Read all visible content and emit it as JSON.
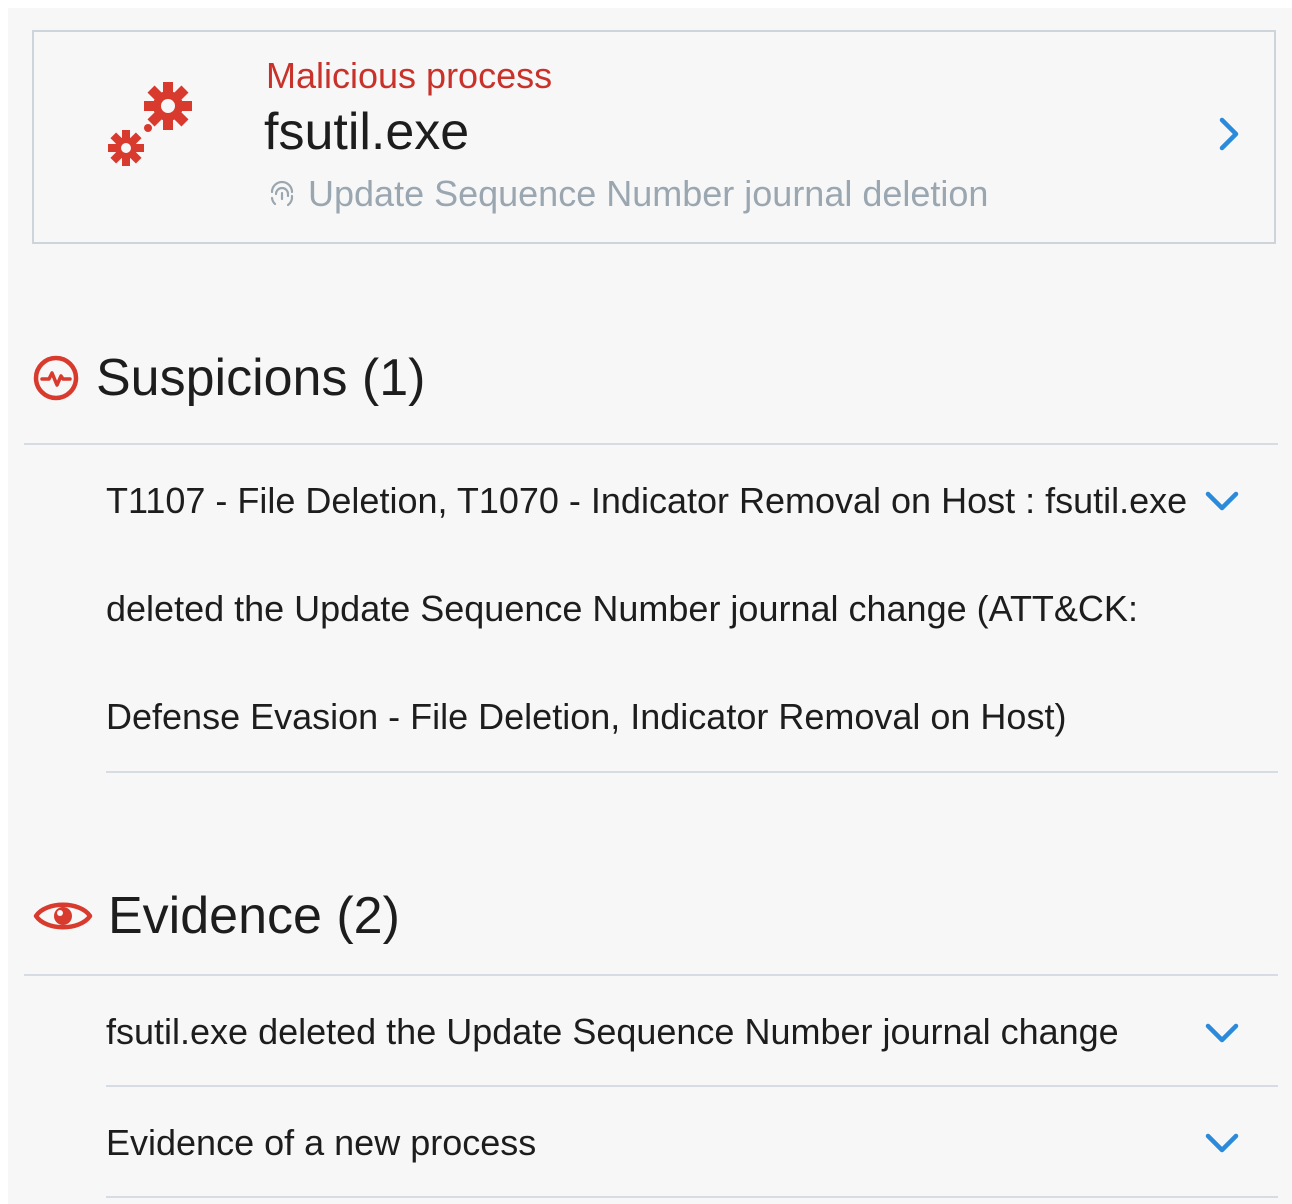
{
  "colors": {
    "accent_red": "#d83a2e",
    "category_red": "#c8322a",
    "link_blue": "#2b8ad9",
    "muted_text": "#9aa6b0",
    "primary_text": "#1d1d1d",
    "divider": "#d6dce1"
  },
  "process_card": {
    "icon": "gears-icon",
    "category": "Malicious process",
    "name": "fsutil.exe",
    "subtitle_icon": "fingerprint-icon",
    "subtitle": "Update Sequence Number journal deletion",
    "action_icon": "chevron-right-icon"
  },
  "suspicions": {
    "icon": "heartbeat-circle-icon",
    "title": "Suspicions (1)",
    "items": [
      {
        "lines": [
          "T1107 - File Deletion, T1070 - Indicator Removal on Host : fsutil.exe",
          "deleted the Update Sequence Number journal change (ATT&CK:",
          "Defense Evasion - File Deletion, Indicator Removal on Host)"
        ],
        "icon": "chevron-down-icon"
      }
    ]
  },
  "evidence": {
    "icon": "eye-icon",
    "title": "Evidence (2)",
    "items": [
      {
        "label": "fsutil.exe deleted the Update Sequence Number journal change",
        "icon": "chevron-down-icon"
      },
      {
        "label": "Evidence of a new process",
        "icon": "chevron-down-icon"
      }
    ]
  }
}
